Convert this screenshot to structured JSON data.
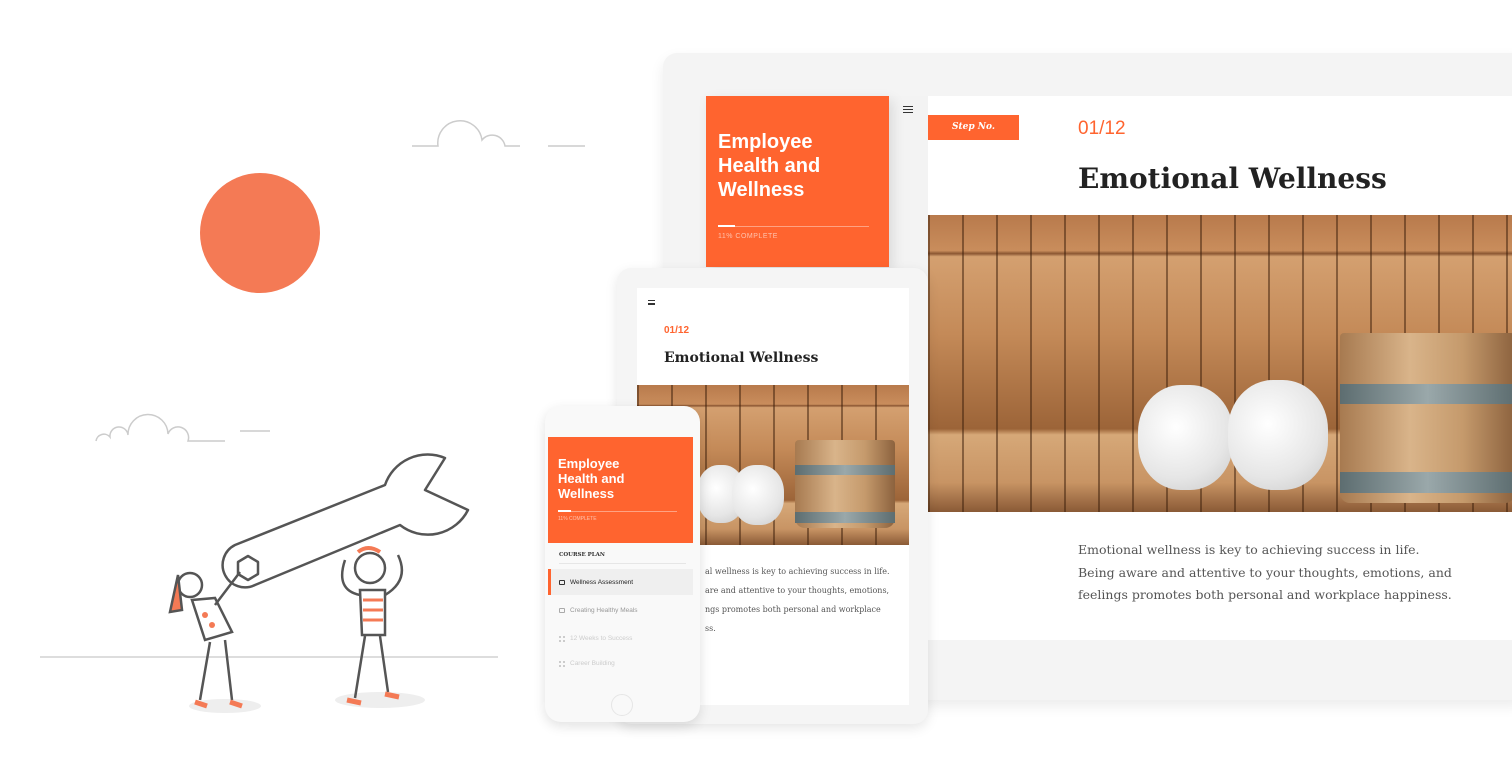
{
  "colors": {
    "accent": "#ff642f",
    "sun": "#f47a55",
    "text": "#222222"
  },
  "course": {
    "title_line1": "Employee",
    "title_line2": "Health and",
    "title_line3": "Wellness",
    "progress_percent": 11,
    "progress_label": "11% COMPLETE"
  },
  "lesson": {
    "step_tag": "Step No.",
    "step": "01/12",
    "title": "Emotional Wellness",
    "body": "Emotional wellness is key to achieving success in life. Being aware and attentive to your thoughts, emotions, and feelings promotes both personal and workplace happiness.",
    "tablet_body_line1": "al wellness is key to achieving success in life.",
    "tablet_body_line2": "are and attentive to your thoughts, emotions,",
    "tablet_body_line3": "ngs promotes both personal and workplace",
    "tablet_body_line4": "ss."
  },
  "course_plan": {
    "heading": "COURSE PLAN",
    "items": [
      {
        "label": "Wellness Assessment",
        "icon": "video-icon",
        "active": true
      },
      {
        "label": "Creating Healthy Meals",
        "icon": "video-icon",
        "active": false
      },
      {
        "label": "12 Weeks to Success",
        "icon": "list-icon",
        "active": false
      },
      {
        "label": "Career Building",
        "icon": "list-icon",
        "active": false
      }
    ]
  }
}
